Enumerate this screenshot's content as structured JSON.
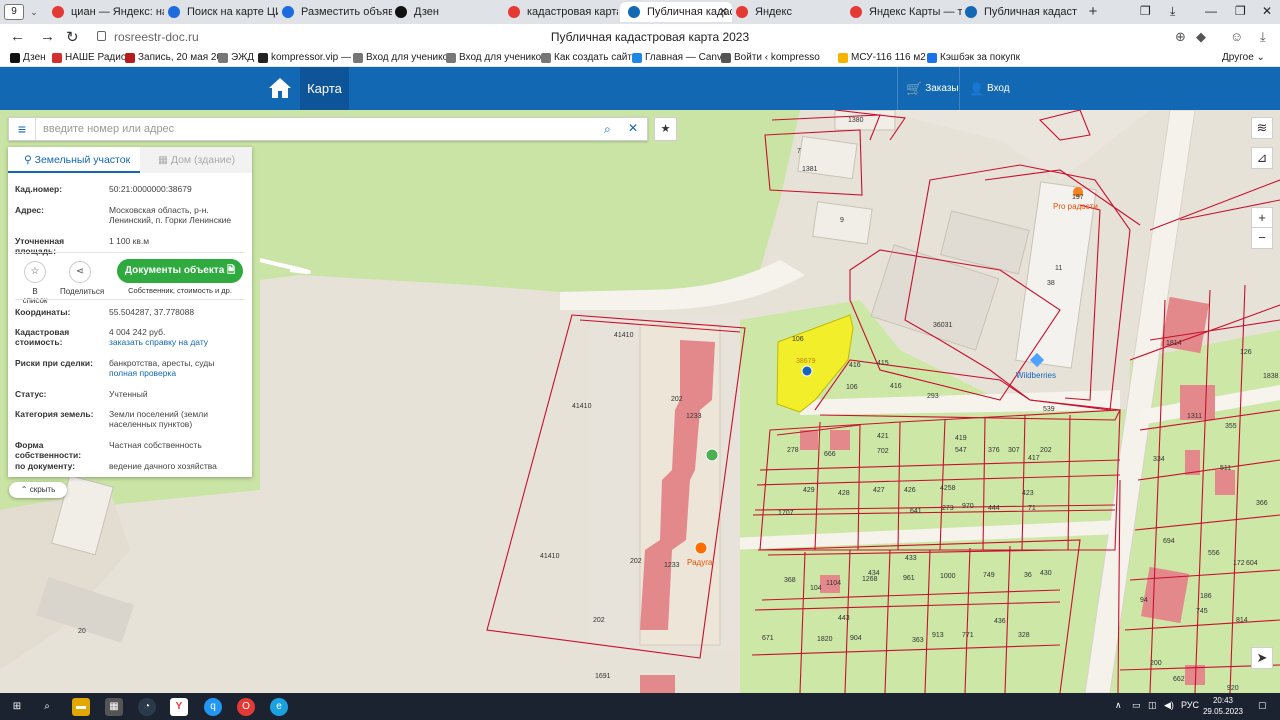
{
  "browser": {
    "tab_count": "9",
    "tabs": [
      {
        "label": "циан — Яндекс: наш",
        "icon": "yandex-icon",
        "color": "#e53935"
      },
      {
        "label": "Поиск на карте ЦИА",
        "icon": "cian-icon",
        "color": "#1e6be0"
      },
      {
        "label": "Разместить объявле",
        "icon": "cian-icon",
        "color": "#1e6be0"
      },
      {
        "label": "Дзен",
        "icon": "dzen-icon",
        "color": "#111111"
      },
      {
        "label": "кадастровая карта —",
        "icon": "yandex-icon",
        "color": "#e53935"
      },
      {
        "label": "Публичная кадаст",
        "icon": "rosreestr-icon",
        "color": "#1268b3"
      },
      {
        "label": "Яндекс",
        "icon": "yandex-icon",
        "color": "#e53935"
      },
      {
        "label": "Яндекс Карты — тра",
        "icon": "map-pin-icon",
        "color": "#e53935"
      },
      {
        "label": "Публичная кадастро",
        "icon": "rosreestr-icon",
        "color": "#1268b3"
      }
    ],
    "url": "rosreestr-doc.ru",
    "page_title": "Публичная кадастровая карта 2023",
    "bookmarks": [
      {
        "label": "Дзен",
        "color": "#111111"
      },
      {
        "label": "НАШЕ Радио",
        "color": "#d32f2f"
      },
      {
        "label": "Запись, 20 мая 20",
        "color": "#b71c1c"
      },
      {
        "label": "ЭЖД",
        "color": "#777777"
      },
      {
        "label": "kompressor.vip —",
        "color": "#222222"
      },
      {
        "label": "Вход для ученико",
        "color": "#777777"
      },
      {
        "label": "Вход для ученико",
        "color": "#777777"
      },
      {
        "label": "Как создать сайт -",
        "color": "#777777"
      },
      {
        "label": "Главная — Canva",
        "color": "#1e88e5"
      },
      {
        "label": "Войти ‹ kompresso",
        "color": "#555555"
      },
      {
        "label": "МСУ-116 116 м2",
        "color": "#f4b400"
      },
      {
        "label": "Кэшбэк за покупк",
        "color": "#1a73e8"
      }
    ],
    "bookmarks_other": "Другое"
  },
  "header": {
    "map_label": "Карта",
    "orders_label": "Заказы",
    "login_label": "Вход"
  },
  "search": {
    "placeholder": "введите номер или адрес"
  },
  "panel": {
    "tab_parcel": "Земельный участок",
    "tab_building": "Дом (здание)",
    "fields": {
      "cad_key": "Кад.номер:",
      "cad_value": "50:21:0000000:38679",
      "addr_key": "Адрес:",
      "addr_value": "Московская область, р-н. Ленинский, п. Горки Ленинские",
      "area_key": "Уточненная площадь:",
      "area_value": "1 100 кв.м",
      "coords_key": "Координаты:",
      "coords_value": "55.504287, 37.778088",
      "cost_key": "Кадастровая стоимость:",
      "cost_value": "4 004 242 руб.",
      "cost_link": "заказать справку на дату",
      "risk_key": "Риски при сделки:",
      "risk_value": "банкротства, аресты, суды",
      "risk_link": "полная проверка",
      "status_key": "Статус:",
      "status_value": "Учтенный",
      "category_key": "Категория земель:",
      "category_value": "Земли поселений (земли населенных пунктов)",
      "ownership_key": "Форма собственности:",
      "ownership_value": "Частная собственность",
      "doc_key": "по документу:",
      "doc_value": "ведение дачного хозяйства"
    },
    "actions": {
      "to_list": "В список",
      "share": "Поделиться",
      "docs_button": "Документы объекта",
      "docs_sub": "Собственник, стоимость и др."
    },
    "hide_label": "скрыть"
  },
  "map_labels": {
    "selected_parcel": "38679",
    "poi_pro": "Pro радости",
    "poi_wildberries": "Wildberries",
    "poi_raduga": "Радуга",
    "numbers": [
      "1380",
      "7",
      "1381",
      "9",
      "197",
      "11",
      "38",
      "36031",
      "41410",
      "41410",
      "41410",
      "202",
      "1233",
      "1233",
      "202",
      "202",
      "416",
      "415",
      "106",
      "416",
      "293",
      "539",
      "1814",
      "126",
      "1311",
      "355",
      "334",
      "511",
      "1838",
      "278",
      "666",
      "421",
      "702",
      "419",
      "547",
      "376",
      "307",
      "417",
      "202",
      "429",
      "428",
      "427",
      "426",
      "4258",
      "423",
      "71",
      "1707",
      "641",
      "273",
      "970",
      "444",
      "694",
      "556",
      "604",
      "172",
      "366",
      "368",
      "104",
      "1104",
      "434",
      "1268",
      "433",
      "961",
      "1000",
      "749",
      "36",
      "430",
      "94",
      "186",
      "745",
      "814",
      "671",
      "1820",
      "904",
      "443",
      "363",
      "913",
      "436",
      "771",
      "328",
      "200",
      "662",
      "920",
      "20",
      "106",
      "1691"
    ]
  },
  "taskbar": {
    "lang": "РУС",
    "time": "20:43",
    "date": "29.05.2023"
  },
  "colors": {
    "header_blue": "#1268b3",
    "parcel_red": "#c8102e",
    "selected_yellow": "#f3ee2a",
    "green_button": "#2eaa3f",
    "map_green": "#c6e3a0"
  }
}
